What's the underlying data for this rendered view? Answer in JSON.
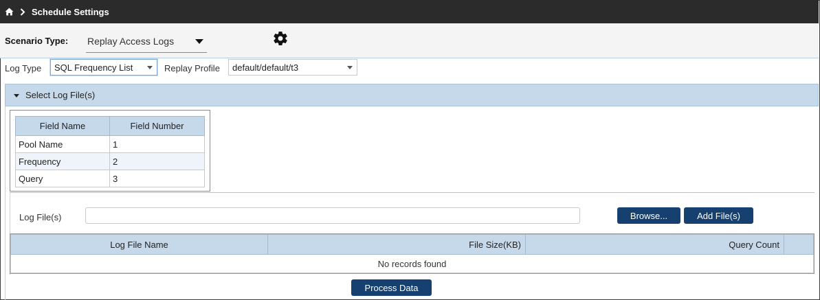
{
  "header": {
    "title": "Schedule Settings",
    "home_icon": "home-icon",
    "separator_icon": "chevron-right-icon",
    "background": "#2b2b2b"
  },
  "scenario": {
    "label": "Scenario Type:",
    "value": "Replay Access Logs",
    "settings_icon": "gear-icon"
  },
  "log_type": {
    "label": "Log Type",
    "value": "SQL Frequency List"
  },
  "replay_profile": {
    "label": "Replay Profile",
    "value": "default/default/t3"
  },
  "section": {
    "title": "Select Log File(s)",
    "accent": "#c6d9eb"
  },
  "field_table": {
    "headers": [
      "Field Name",
      "Field Number"
    ],
    "rows": [
      [
        "Pool Name",
        "1"
      ],
      [
        "Frequency",
        "2"
      ],
      [
        "Query",
        "3"
      ]
    ]
  },
  "log_files": {
    "label": "Log File(s)",
    "input_value": "",
    "browse_label": "Browse...",
    "add_label": "Add File(s)",
    "columns": [
      "Log File Name",
      "File Size(KB)",
      "Query Count"
    ],
    "empty_message": "No records found"
  },
  "process_label": "Process Data",
  "button_color": "#15406f"
}
